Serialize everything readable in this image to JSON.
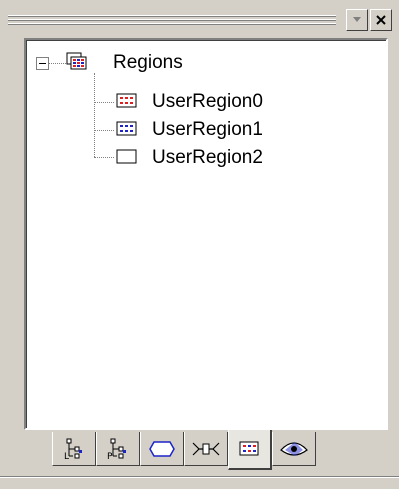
{
  "window": {
    "buttons": [
      {
        "name": "dropdown",
        "icon": "dropdown-arrow-icon"
      },
      {
        "name": "close",
        "icon": "close-icon"
      }
    ]
  },
  "tree": {
    "root": {
      "label": "Regions",
      "icon": "regions-icon",
      "expanded": true
    },
    "children": [
      {
        "label": "UserRegion0",
        "icon": "region-red-grid-icon",
        "accent": "#e02020"
      },
      {
        "label": "UserRegion1",
        "icon": "region-blue-grid-icon",
        "accent": "#1c24c8"
      },
      {
        "label": "UserRegion2",
        "icon": "region-empty-icon",
        "accent": "#000000"
      }
    ]
  },
  "tabs": [
    {
      "name": "tree-l-tab",
      "icon": "tree-l-icon"
    },
    {
      "name": "tree-p-tab",
      "icon": "tree-p-icon"
    },
    {
      "name": "shape-tab",
      "icon": "hexagon-icon"
    },
    {
      "name": "connector-tab",
      "icon": "connector-icon"
    },
    {
      "name": "regions-tab",
      "icon": "regions-icon",
      "active": true
    },
    {
      "name": "view-tab",
      "icon": "eye-shape-icon"
    }
  ],
  "colors": {
    "face": "#d4d0c8",
    "window": "#ffffff",
    "red_accent": "#e02020",
    "blue_accent": "#1c24c8"
  }
}
